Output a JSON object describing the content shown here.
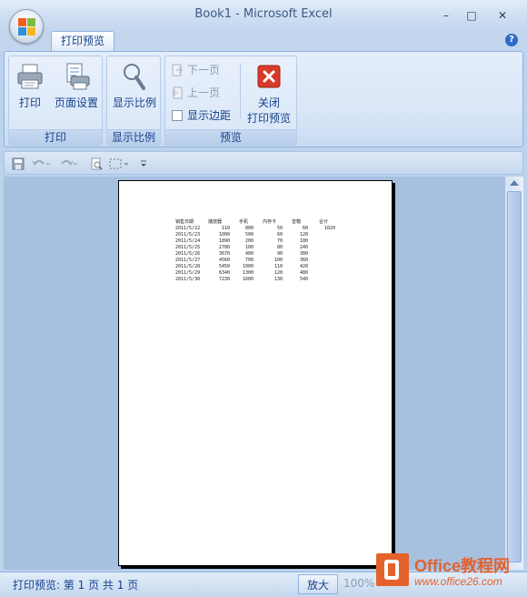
{
  "window": {
    "title": "Book1 - Microsoft Excel",
    "minimize_glyph": "–",
    "maximize_glyph": "□",
    "close_glyph": "✕",
    "help_glyph": "?"
  },
  "tabs": [
    {
      "label": "打印预览",
      "active": true
    }
  ],
  "ribbon": {
    "groups": {
      "print": {
        "label": "打印",
        "buttons": [
          {
            "label": "打印",
            "icon": "printer-icon"
          },
          {
            "label": "页面设置",
            "icon": "page-setup-icon"
          }
        ]
      },
      "zoom": {
        "label": "显示比例",
        "buttons": [
          {
            "label": "显示比例",
            "icon": "magnifier-icon"
          }
        ]
      },
      "preview": {
        "label": "预览",
        "small_buttons": [
          {
            "label": "下一页",
            "icon": "next-page-icon",
            "enabled": false
          },
          {
            "label": "上一页",
            "icon": "previous-page-icon",
            "enabled": false
          },
          {
            "label": "显示边距",
            "icon": "checkbox-icon",
            "checked": false
          }
        ],
        "close_button": {
          "label_line1": "关闭",
          "label_line2": "打印预览",
          "icon": "close-icon"
        }
      }
    }
  },
  "sheet": {
    "headers": [
      "销售日期",
      "播放器",
      "手机",
      "内存卡",
      "音箱",
      "合计"
    ],
    "rows": [
      [
        "2011/5/22",
        "110",
        "800",
        "50",
        "60",
        "1020"
      ],
      [
        "2011/5/23",
        "1000",
        "500",
        "60",
        "120",
        ""
      ],
      [
        "2011/5/24",
        "1890",
        "200",
        "70",
        "180",
        ""
      ],
      [
        "2011/5/25",
        "2780",
        "100",
        "80",
        "240",
        ""
      ],
      [
        "2011/5/26",
        "3670",
        "400",
        "90",
        "300",
        ""
      ],
      [
        "2011/5/27",
        "4560",
        "700",
        "100",
        "360",
        ""
      ],
      [
        "2011/5/28",
        "5450",
        "1000",
        "110",
        "420",
        ""
      ],
      [
        "2011/5/29",
        "6340",
        "1300",
        "120",
        "480",
        ""
      ],
      [
        "2011/5/30",
        "7230",
        "1600",
        "130",
        "540",
        ""
      ]
    ]
  },
  "status": {
    "text": "打印预览: 第 1 页  共 1 页",
    "zoom_in_label": "放大",
    "zoom_value": "100%"
  },
  "watermark": {
    "title": "Office教程网",
    "url": "www.office26.com"
  },
  "colors": {
    "accent": "#15428b",
    "close_red": "#d83a2a",
    "watermark_orange": "#e3622b"
  }
}
